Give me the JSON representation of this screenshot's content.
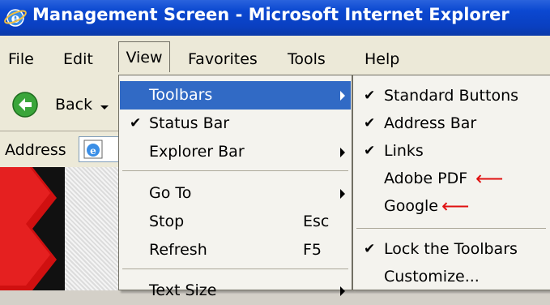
{
  "window": {
    "title": "Management Screen - Microsoft Internet Explorer"
  },
  "menubar": {
    "items": [
      "File",
      "Edit",
      "View",
      "Favorites",
      "Tools",
      "Help"
    ]
  },
  "toolbar": {
    "back_label": "Back",
    "address_label": "Address"
  },
  "view_menu": {
    "items": [
      {
        "label": "Toolbars",
        "has_submenu": true,
        "selected": true
      },
      {
        "label": "Status Bar",
        "checked": true
      },
      {
        "label": "Explorer Bar",
        "has_submenu": true
      },
      {
        "label": "Go To",
        "has_submenu": true
      },
      {
        "label": "Stop",
        "shortcut": "Esc"
      },
      {
        "label": "Refresh",
        "shortcut": "F5"
      },
      {
        "label": "Text Size",
        "has_submenu": true
      }
    ]
  },
  "toolbars_submenu": {
    "items": [
      {
        "label": "Standard Buttons",
        "checked": true
      },
      {
        "label": "Address Bar",
        "checked": true
      },
      {
        "label": "Links",
        "checked": true
      },
      {
        "label": "Adobe PDF",
        "checked": false,
        "annotated": true
      },
      {
        "label": "Google",
        "checked": false,
        "annotated": true
      },
      {
        "label": "Lock the Toolbars",
        "checked": true
      },
      {
        "label": "Customize..."
      }
    ]
  },
  "colors": {
    "title_bar": "#0a3fc0",
    "menu_highlight": "#316ac5",
    "annotation_arrow": "#e01010"
  }
}
